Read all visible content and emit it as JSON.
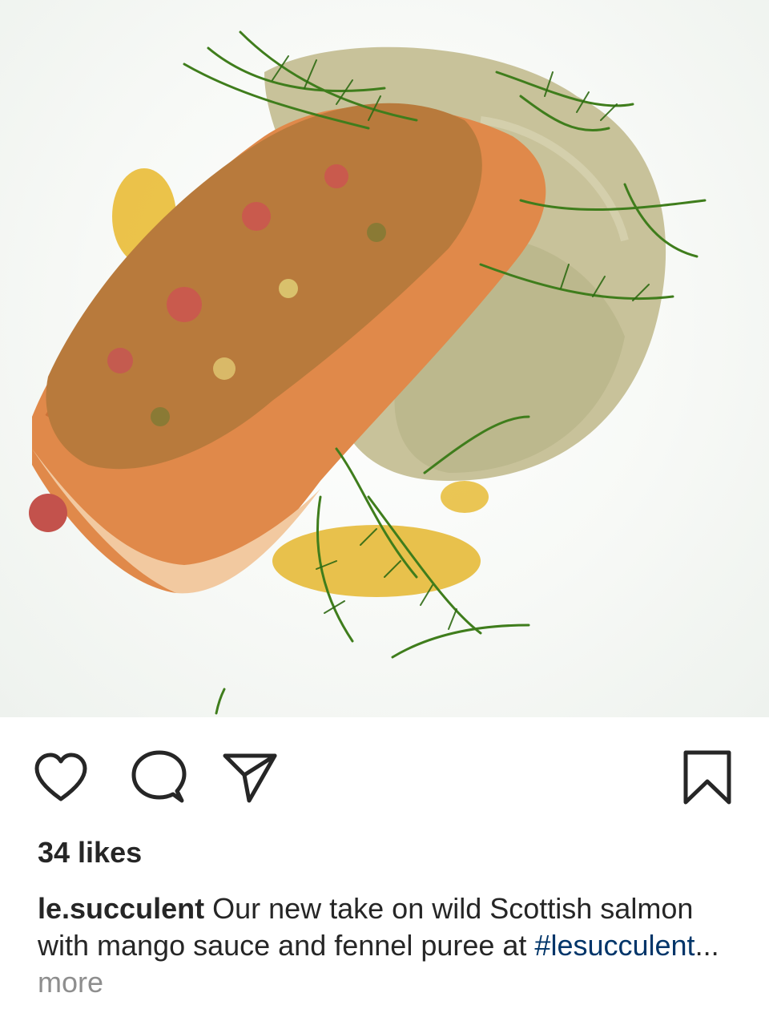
{
  "post": {
    "image_alt": "Pan-seared salmon fillet topped with mango sauce and fennel fronds on fennel puree",
    "icons": {
      "like": "heart-icon",
      "comment": "comment-bubble-icon",
      "share": "paper-plane-icon",
      "save": "bookmark-icon"
    },
    "likes_text": "34 likes",
    "caption": {
      "username": "le.succulent",
      "text_part": " Our new take on wild Scottish salmon with mango sauce and fennel puree at ",
      "hashtag": "#lesucculent",
      "ellipsis": "...",
      "more_label": " more"
    }
  }
}
